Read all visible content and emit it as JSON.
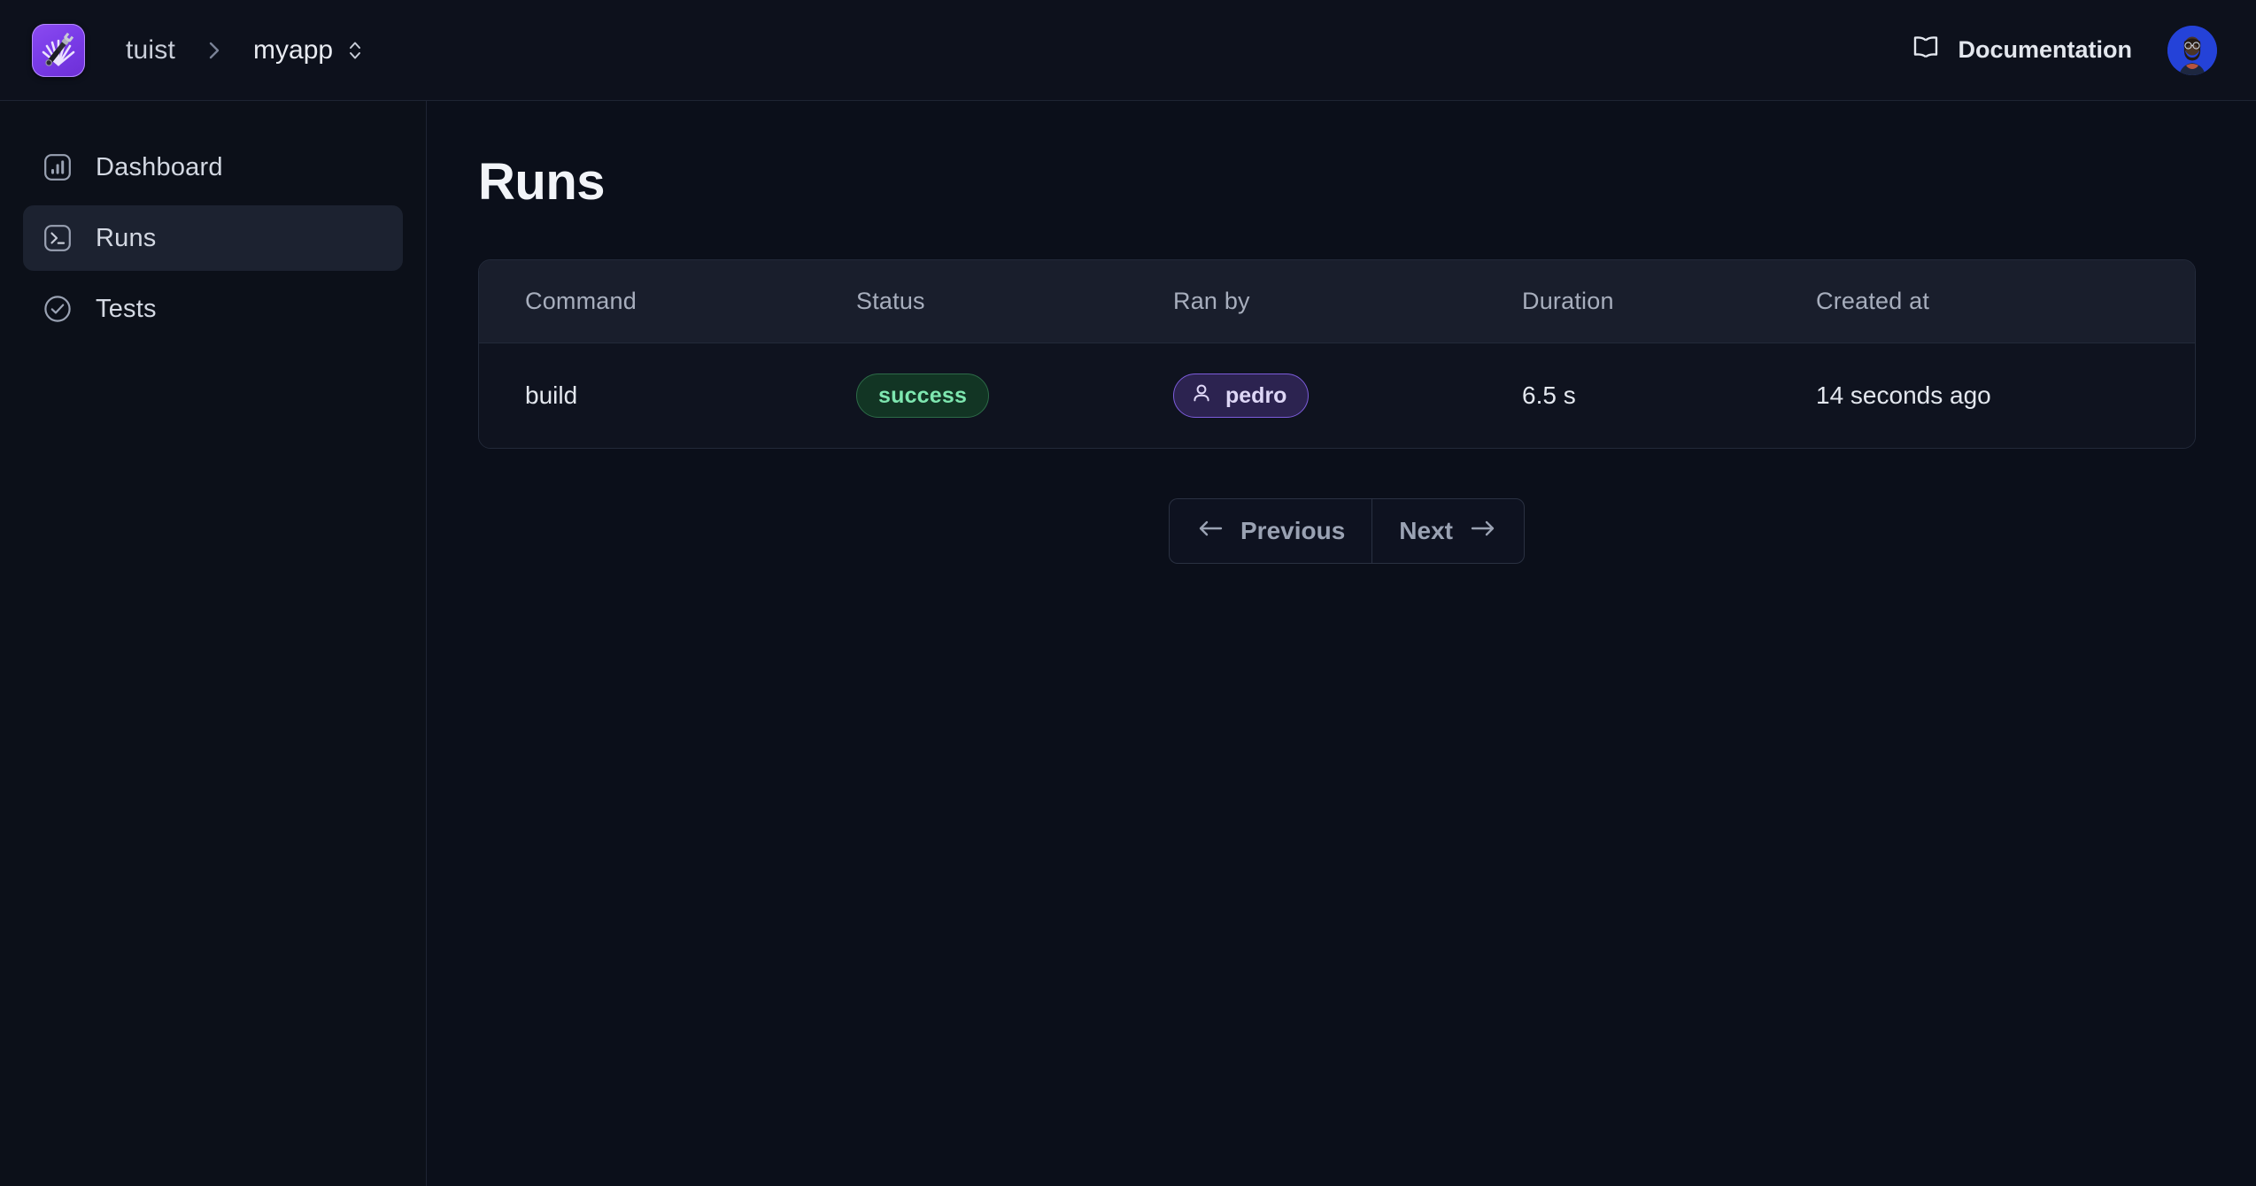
{
  "topbar": {
    "logo_icon": "tuist-wrench-logo-icon",
    "breadcrumb": {
      "account": "tuist",
      "separator": "›",
      "project": "myapp",
      "selector_icon": "chevron-up-down-icon"
    },
    "documentation_label": "Documentation",
    "documentation_icon": "book-icon",
    "avatar_icon": "user-avatar",
    "avatar_bg": "#2442d8"
  },
  "sidebar": {
    "items": [
      {
        "label": "Dashboard",
        "icon": "bar-chart-square-icon",
        "active": false
      },
      {
        "label": "Runs",
        "icon": "terminal-square-icon",
        "active": true
      },
      {
        "label": "Tests",
        "icon": "circle-check-icon",
        "active": false
      }
    ]
  },
  "main": {
    "page_title": "Runs",
    "table": {
      "columns": [
        "Command",
        "Status",
        "Ran by",
        "Duration",
        "Created at"
      ],
      "rows": [
        {
          "command": "build",
          "status": "success",
          "status_color": "#7ee7b0",
          "ran_by": "pedro",
          "ran_by_icon": "user-icon",
          "ran_by_color": "#7c5cdb",
          "duration": "6.5 s",
          "created_at": "14 seconds ago"
        }
      ]
    },
    "pagination": {
      "previous_label": "Previous",
      "previous_icon": "arrow-left-icon",
      "next_label": "Next",
      "next_icon": "arrow-right-icon"
    }
  }
}
